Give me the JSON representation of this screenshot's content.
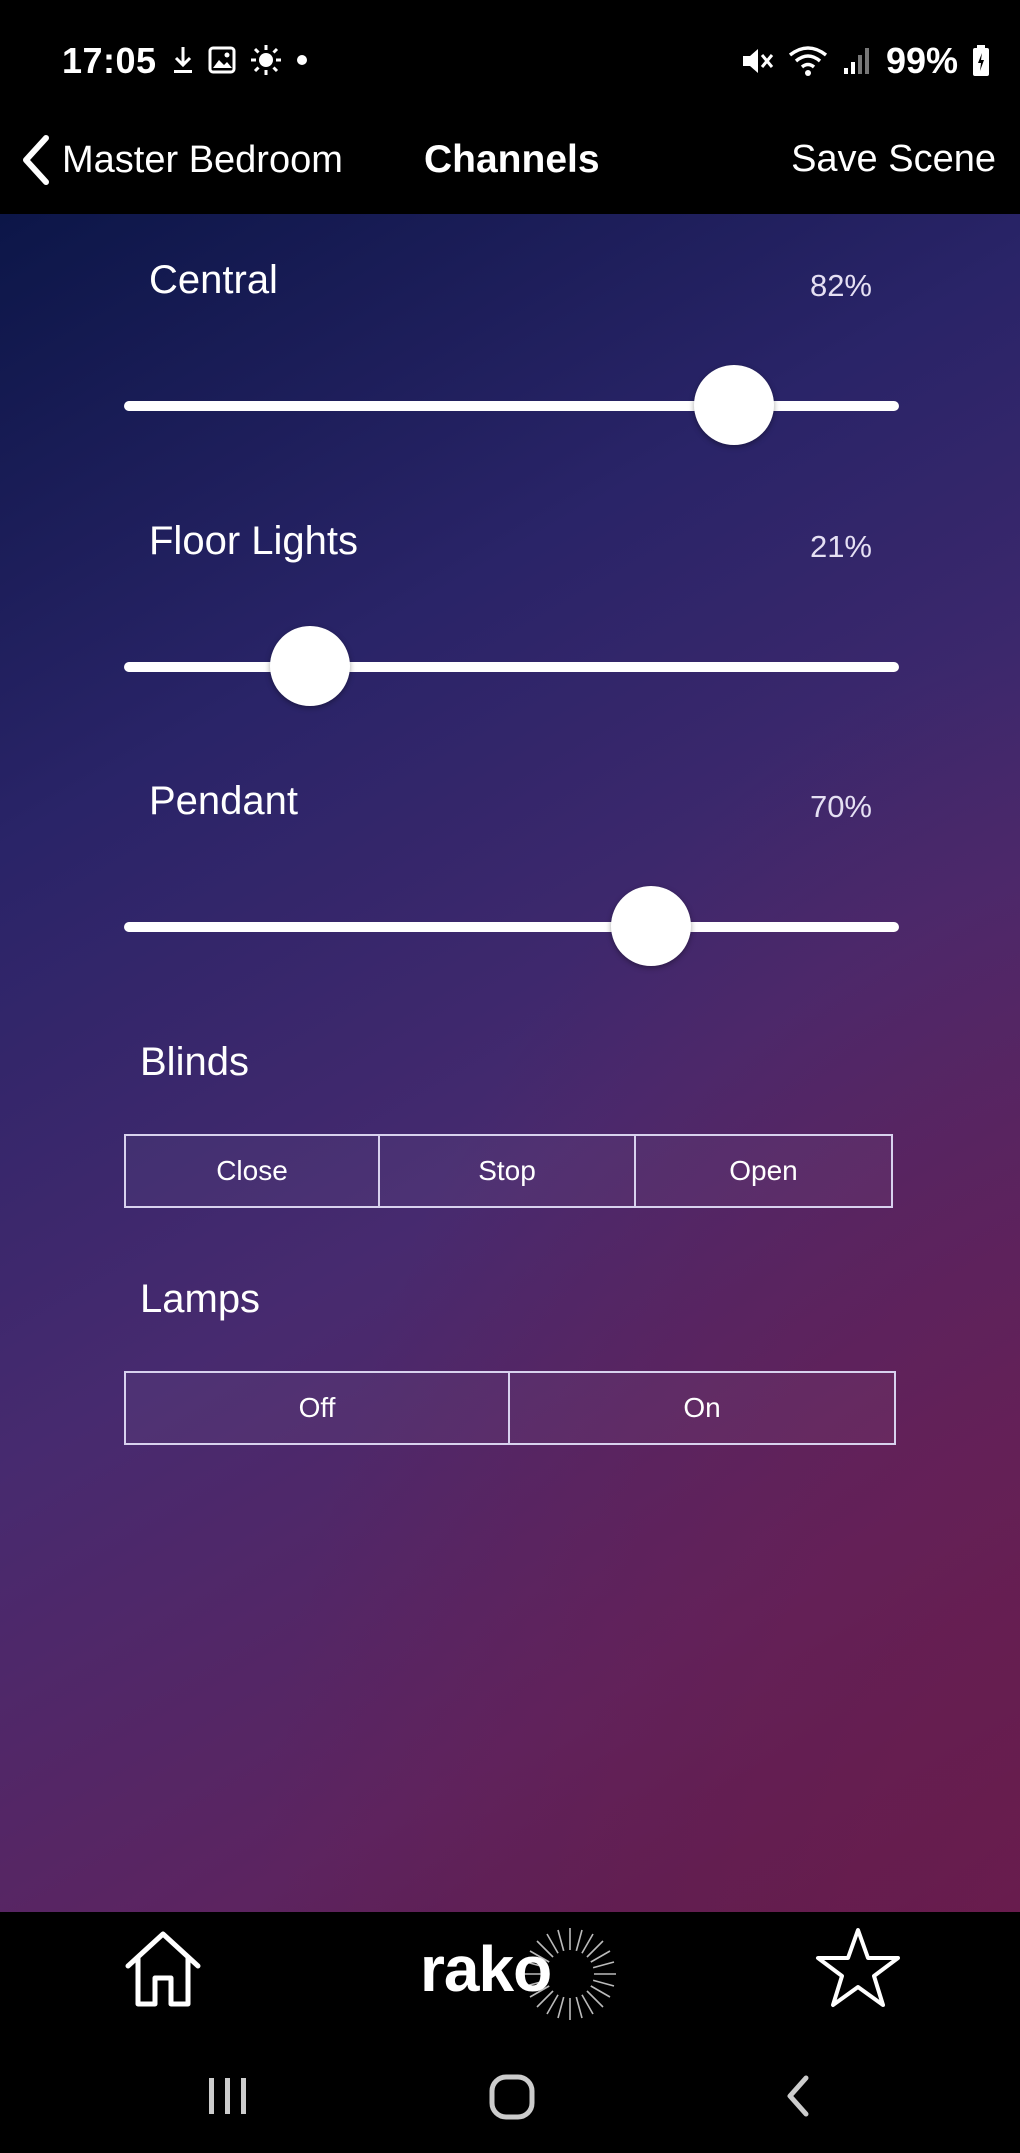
{
  "status_bar": {
    "time": "17:05",
    "left_icons": [
      "download-icon",
      "image-icon",
      "brightness-icon",
      "dot-icon"
    ],
    "right_icons": [
      "mute-icon",
      "wifi-icon",
      "signal-icon"
    ],
    "battery": "99%"
  },
  "header": {
    "back_label": "Master Bedroom",
    "title": "Channels",
    "save_label": "Save Scene"
  },
  "channels": [
    {
      "label": "Central",
      "value_text": "82%",
      "level": 0.82
    },
    {
      "label": "Floor Lights",
      "value_text": "21%",
      "level": 0.21
    },
    {
      "label": "Pendant",
      "value_text": "70%",
      "level": 0.7
    }
  ],
  "blinds": {
    "label": "Blinds",
    "buttons": [
      "Close",
      "Stop",
      "Open"
    ]
  },
  "lamps": {
    "label": "Lamps",
    "buttons": [
      "Off",
      "On"
    ]
  },
  "bottom_bar": {
    "logo_text": "rako",
    "home_icon": "home-icon",
    "favorites_icon": "star-icon"
  },
  "colors": {
    "accent": "#ffffff",
    "background_top": "#0c1648",
    "background_bottom": "#6b1d4f"
  }
}
